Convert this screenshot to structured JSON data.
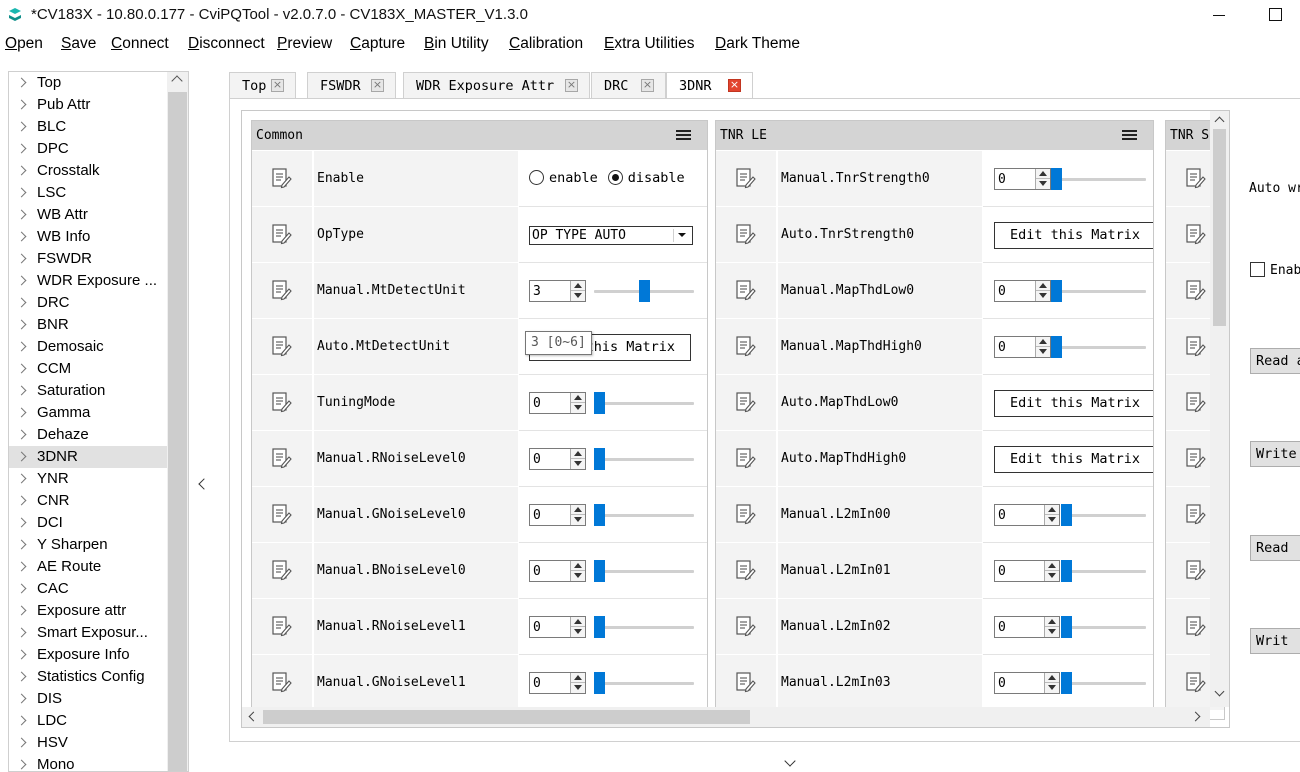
{
  "window": {
    "title": "*CV183X - 10.80.0.177 - CviPQTool - v2.0.7.0 - CV183X_MASTER_V1.3.0"
  },
  "menu": [
    "Open",
    "Save",
    "Connect",
    "Disconnect",
    "Preview",
    "Capture",
    "Bin Utility",
    "Calibration",
    "Extra Utilities",
    "Dark Theme"
  ],
  "tree": {
    "selected": "3DNR",
    "items": [
      "Top",
      "Pub Attr",
      "BLC",
      "DPC",
      "Crosstalk",
      "LSC",
      "WB Attr",
      "WB Info",
      "FSWDR",
      "WDR Exposure ...",
      "DRC",
      "BNR",
      "Demosaic",
      "CCM",
      "Saturation",
      "Gamma",
      "Dehaze",
      "3DNR",
      "YNR",
      "CNR",
      "DCI",
      "Y Sharpen",
      "AE Route",
      "CAC",
      "Exposure attr",
      "Smart Exposur...",
      "Exposure Info",
      "Statistics Config",
      "DIS",
      "LDC",
      "HSV",
      "Mono"
    ]
  },
  "tabs": [
    {
      "label": "Top",
      "active": false
    },
    {
      "label": "FSWDR",
      "active": false
    },
    {
      "label": "WDR Exposure Attr",
      "active": false
    },
    {
      "label": "DRC",
      "active": false
    },
    {
      "label": "3DNR",
      "active": true
    }
  ],
  "groups": [
    {
      "title": "Common",
      "rows": [
        {
          "name": "Enable",
          "control": "radio",
          "options": [
            "enable",
            "disable"
          ],
          "selected": "disable"
        },
        {
          "name": "OpType",
          "control": "combo",
          "value": "OP TYPE AUTO"
        },
        {
          "name": "Manual.MtDetectUnit",
          "control": "spin",
          "value": "3",
          "level": 0.5
        },
        {
          "name": "Auto.MtDetectUnit",
          "control": "button",
          "label": "Edit this Matrix"
        },
        {
          "name": "TuningMode",
          "control": "spin",
          "value": "0",
          "level": 0
        },
        {
          "name": "Manual.RNoiseLevel0",
          "control": "spin",
          "value": "0",
          "level": 0
        },
        {
          "name": "Manual.GNoiseLevel0",
          "control": "spin",
          "value": "0",
          "level": 0
        },
        {
          "name": "Manual.BNoiseLevel0",
          "control": "spin",
          "value": "0",
          "level": 0
        },
        {
          "name": "Manual.RNoiseLevel1",
          "control": "spin",
          "value": "0",
          "level": 0
        },
        {
          "name": "Manual.GNoiseLevel1",
          "control": "spin",
          "value": "0",
          "level": 0
        }
      ]
    },
    {
      "title": "TNR LE",
      "rows": [
        {
          "name": "Manual.TnrStrength0",
          "control": "spin",
          "value": "0",
          "level": 0
        },
        {
          "name": "Auto.TnrStrength0",
          "control": "button",
          "label": "Edit this Matrix"
        },
        {
          "name": "Manual.MapThdLow0",
          "control": "spin",
          "value": "0",
          "level": 0
        },
        {
          "name": "Manual.MapThdHigh0",
          "control": "spin",
          "value": "0",
          "level": 0
        },
        {
          "name": "Auto.MapThdLow0",
          "control": "button",
          "label": "Edit this Matrix"
        },
        {
          "name": "Auto.MapThdHigh0",
          "control": "button",
          "label": "Edit this Matrix"
        },
        {
          "name": "Manual.L2mIn00",
          "control": "spin",
          "value": "0",
          "level": 0
        },
        {
          "name": "Manual.L2mIn01",
          "control": "spin",
          "value": "0",
          "level": 0
        },
        {
          "name": "Manual.L2mIn02",
          "control": "spin",
          "value": "0",
          "level": 0
        },
        {
          "name": "Manual.L2mIn03",
          "control": "spin",
          "value": "0",
          "level": 0
        }
      ]
    },
    {
      "title": "TNR S",
      "rows": [
        {},
        {},
        {},
        {},
        {},
        {},
        {},
        {},
        {},
        {}
      ]
    }
  ],
  "tooltip": "3 [0~6]",
  "right_panel": {
    "auto_write_label": "Auto wr",
    "enable_label": "Enab",
    "buttons": [
      "Read a",
      "Write",
      "Read",
      "Writ"
    ]
  },
  "colors": {
    "slider_thumb": "#0078d7",
    "active_tab_close": "#e2442f",
    "group_header": "#d4d4d4",
    "selected_tree_item": "#e1e1e1"
  },
  "icons": [
    "app-logo-icon",
    "edit-row-icon",
    "list-menu-icon",
    "chevron-right-icon",
    "close-icon"
  ]
}
